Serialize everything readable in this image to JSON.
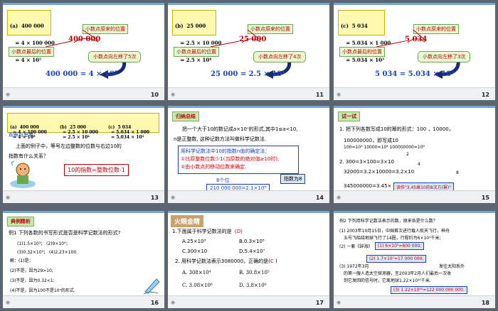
{
  "slides": [
    {
      "number": "10",
      "box_label": "(a)",
      "box_lines": [
        "400 000",
        "= 4 × 100 000",
        "= 4 × 10⁵"
      ],
      "number_shown": "400 000",
      "original_point": "小数点原来的位置",
      "final_point": "小数点最后的位置",
      "move_note": "小数点向左移了5次",
      "result": "400 000  = 4 × 10⁵"
    },
    {
      "number": "11",
      "box_label": "(b)",
      "box_lines": [
        "25 000",
        "= 2.5 × 10 000",
        "= 2.5 × 10⁴"
      ],
      "number_shown": "25 000",
      "original_point": "小数点原来的位置",
      "final_point": "小数点最后的位置",
      "move_note": "小数点向左移了4次",
      "result": "25 000 = 2.5 × 10⁴"
    },
    {
      "number": "12",
      "box_label": "(c)",
      "box_lines": [
        "5 034",
        "= 5.034 × 1 000",
        "= 5.034 × 10³"
      ],
      "number_shown": "5 034",
      "original_point": "小数点原来的位置",
      "final_point": "小数点最后的位置",
      "move_note": "小数点向左移了3次",
      "result": "5 034 = 5.034 × 10³"
    },
    {
      "number": "13",
      "col_a": [
        "(a)  400 000",
        "= 4 × 100 000",
        "= 4 × 10⁵"
      ],
      "col_b": [
        "(b)  25 000",
        "= 2.5 × 10 000",
        "= 2.5 × 10⁴"
      ],
      "col_c": [
        "(c)  5 034",
        "= 5.034 × 1 000",
        "= 5.034 × 10³"
      ],
      "heading": "观察与思考:",
      "question_1": "上面的例子中，等号左边整数的位数与右边10的",
      "question_2": "指数有什么关系？",
      "answer": "10的指数=整数位数-1"
    },
    {
      "number": "14",
      "tag": "归纳总结",
      "para_1": "把一个大于10的数记成a×10ⁿ的形式,其中1≤a<10,",
      "para_2": "n是正整数, 这种记数方法叫做科学记数法.",
      "rule_title": "用科学记数法中10的指数n值的确定法：",
      "rule_1": "①比原整数位数少1(当原数的绝对值≥10时);",
      "rule_2": "②由小数点的移动位数来确定.",
      "digits_label": "8个位",
      "example": "210 000 000=2.1×10⁸",
      "exponent_note": "指数为8"
    },
    {
      "number": "15",
      "tag": "试一试",
      "q1_a": "1. 把下列各数写成10的幂的形式：100 ，10000，",
      "q1_b": "100000000，即写成10",
      "a1": "100=10²   10000=10⁴        100000000=10⁸",
      "q2_a": "2. 300=3×100=3×10",
      "q2_b": "32000=3.2×10000=3.2×10",
      "q2_c": "345000000=3.45×",
      "hint": "读作\"3.45乘10的8次方(幂)\"",
      "exp_2": "2",
      "exp_4": "4",
      "exp_8": "8"
    },
    {
      "number": "16",
      "tag": "典例精析",
      "ex": "例1  下列各数的书写形式是否是科学记数法的形式?",
      "items_1": "(1)1.5×10³；       (2)9×10⁴；",
      "items_2": "(3)0.32×10³；      (4)2.23×100.",
      "sol_head": "解：(1)是；",
      "sol_2": "(2)不是，因为29>10;",
      "sol_3": "(3)不是，因为0.32<1;",
      "sol_4": "(4)不是，因为100不是10ⁿ的形式."
    },
    {
      "number": "17",
      "tag": "火眼金睛",
      "q1": "1.下面属于科学记数法的是（",
      "q1_ans": "D",
      "opt_a": "A.25×10³",
      "opt_b": "B.0.3×10⁵",
      "opt_c": "C.300×10",
      "opt_d": "D.5.4×10⁷",
      "q2": "2. 用科学记数法表示3080000，正确的是(",
      "q2_ans": "C",
      "o2_a": "A.  308×10⁴",
      "o2_b": "B.  30.8×10⁵",
      "o2_c": "C.  3.08×10⁶",
      "o2_d": "D.  3.8×10⁶"
    },
    {
      "number": "18",
      "ex": "例2  下列用科学记数法表示的数，原来各是什么数？",
      "l1": "(1) 2003年10月15日，中国首次进行载人航天飞行，神舟",
      "l2": "五号飞船绕地球飞行了14圈，行程约为6×10⁵千米;",
      "a1": "(1) 6×10⁵=600 000;",
      "l3": "(2) 一套《辞海》",
      "a2": "(2) 1.7×10⁷=17 000 000;",
      "l4": "(3) 1972年3月",
      "l4b": "发往太阳系外",
      "l5": "的第一艘人造太空探测器，至2003年2月人们最后一次收",
      "l6": "到它发回的信号时，它离地球1.22×10¹⁰千米.",
      "a3": "(3) 1.22×10¹⁰=122 000 000 000."
    }
  ],
  "colors": {
    "background": "#5c6470",
    "slide_bg": "#ffffff",
    "accent_blue": "#1a3fbf",
    "accent_red": "#e00000",
    "callout_green": "#e8f8d0",
    "highlight_yellow": "#fff9b0"
  }
}
